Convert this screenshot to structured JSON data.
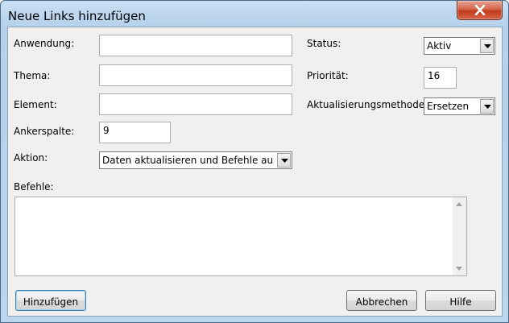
{
  "window": {
    "title": "Neue Links hinzufügen"
  },
  "form": {
    "anwendung_label": "Anwendung:",
    "anwendung_value": "",
    "thema_label": "Thema:",
    "thema_value": "",
    "element_label": "Element:",
    "element_value": "",
    "ankerspalte_label": "Ankerspalte:",
    "ankerspalte_value": "9",
    "aktion_label": "Aktion:",
    "aktion_value": "Daten aktualisieren und Befehle ausführen",
    "befehle_label": "Befehle:",
    "befehle_value": "",
    "status_label": "Status:",
    "status_value": "Aktiv",
    "prioritaet_label": "Priorität:",
    "prioritaet_value": "16",
    "methode_label": "Aktualisierungsmethode:",
    "methode_value": "Ersetzen"
  },
  "buttons": {
    "add": "Hinzufügen",
    "cancel": "Abbrechen",
    "help": "Hilfe"
  }
}
